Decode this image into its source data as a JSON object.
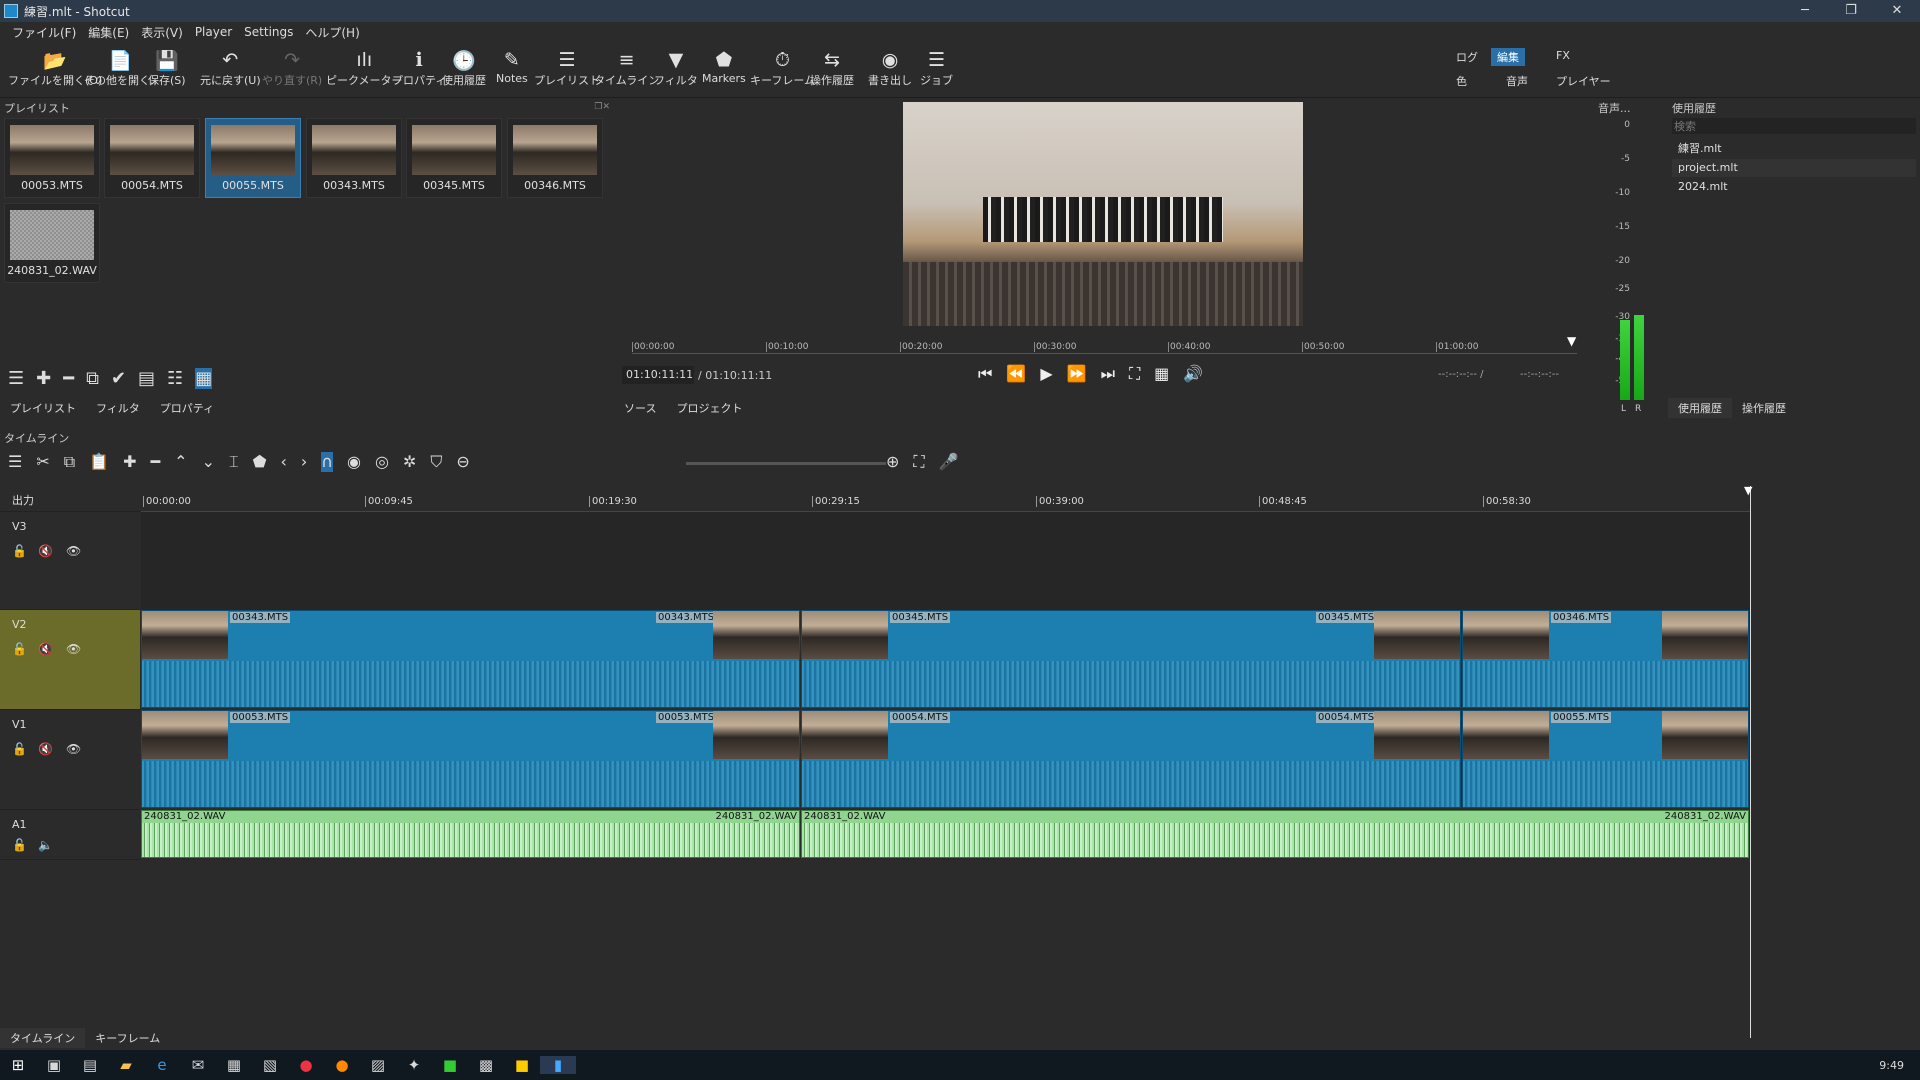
{
  "window": {
    "title": "練習.mlt - Shotcut",
    "minimize": "─",
    "restore": "❐",
    "close": "✕"
  },
  "menu": [
    "ファイル(F)",
    "編集(E)",
    "表示(V)",
    "Player",
    "Settings",
    "ヘルプ(H)"
  ],
  "toolbar": [
    {
      "label": "ファイルを開く(O)",
      "icon": "📂"
    },
    {
      "label": "その他を開く..",
      "icon": "📄"
    },
    {
      "label": "保存(S)",
      "icon": "💾"
    },
    {
      "label": "元に戻す(U)",
      "icon": "↶"
    },
    {
      "label": "やり直す(R)",
      "icon": "↷",
      "disabled": true
    },
    {
      "label": "ピークメーター",
      "icon": "ılı"
    },
    {
      "label": "プロパティ",
      "icon": "ℹ"
    },
    {
      "label": "使用履歴",
      "icon": "🕒"
    },
    {
      "label": "Notes",
      "icon": "✎"
    },
    {
      "label": "プレイリスト",
      "icon": "☰"
    },
    {
      "label": "タイムライン",
      "icon": "≡"
    },
    {
      "label": "フィルタ",
      "icon": "▼"
    },
    {
      "label": "Markers",
      "icon": "⬟"
    },
    {
      "label": "キーフレーム",
      "icon": "⏱"
    },
    {
      "label": "操作履歴",
      "icon": "⇆"
    },
    {
      "label": "書き出し",
      "icon": "◉"
    },
    {
      "label": "ジョブ",
      "icon": "☰"
    }
  ],
  "layouts": {
    "row1": [
      "ログ",
      "編集",
      "FX"
    ],
    "row2": [
      "色",
      "音声",
      "プレイヤー"
    ],
    "active": "編集"
  },
  "playlist": {
    "title": "プレイリスト",
    "clips": [
      "00053.MTS",
      "00054.MTS",
      "00055.MTS",
      "00343.MTS",
      "00345.MTS",
      "00346.MTS",
      "240831_02.WAV"
    ],
    "selected": "00055.MTS",
    "tabs": [
      "プレイリスト",
      "フィルタ",
      "プロパティ"
    ]
  },
  "viewer": {
    "ruler": [
      "00:00:00",
      "00:10:00",
      "00:20:00",
      "00:30:00",
      "00:40:00",
      "00:50:00",
      "01:00:00"
    ],
    "position": "01:10:11:11",
    "duration": "/ 01:10:11:11",
    "in_out": "--:--:--:-- /",
    "in_out2": "--:--:--:--",
    "tabs": [
      "ソース",
      "プロジェクト"
    ]
  },
  "meter": {
    "title": "音声...",
    "scale": [
      "0",
      "-5",
      "-10",
      "-15",
      "-20",
      "-25",
      "-30",
      "-35",
      "-40",
      "-50"
    ],
    "channels": [
      "L",
      "R"
    ],
    "levels": [
      0.32,
      0.34
    ]
  },
  "history": {
    "title": "使用履歴",
    "search_placeholder": "検索",
    "items": [
      "練習.mlt",
      "project.mlt",
      "2024.mlt"
    ],
    "tabs": [
      "使用履歴",
      "操作履歴"
    ]
  },
  "timeline": {
    "title": "タイムライン",
    "output": "出力",
    "ruler": [
      "00:00:00",
      "00:09:45",
      "00:19:30",
      "00:29:15",
      "00:39:00",
      "00:48:45",
      "00:58:30"
    ],
    "tracks": [
      {
        "name": "V3"
      },
      {
        "name": "V2",
        "clips": [
          "00343.MTS",
          "00343.MTS",
          "00345.MTS",
          "00345.MTS",
          "00346.MTS"
        ]
      },
      {
        "name": "V1",
        "clips": [
          "00053.MTS",
          "00053.MTS",
          "00054.MTS",
          "00054.MTS",
          "00055.MTS"
        ]
      },
      {
        "name": "A1",
        "clips": [
          "240831_02.WAV",
          "240831_02.WAV",
          "240831_02.WAV",
          "240831_02.WAV"
        ]
      }
    ]
  },
  "bottom_tabs": [
    "タイムライン",
    "キーフレーム"
  ],
  "taskbar": {
    "clock": "9:49"
  }
}
